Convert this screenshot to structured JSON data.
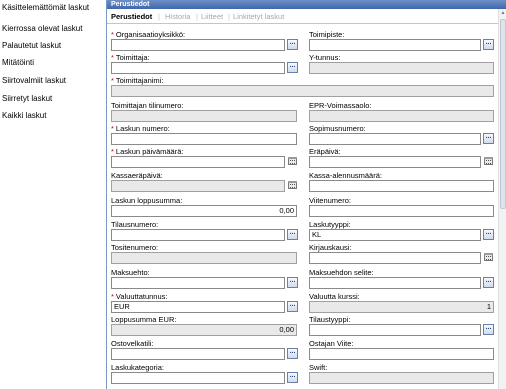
{
  "nav": {
    "items": [
      "Käsittelemättömät laskut",
      "Kierrossa olevat laskut",
      "Palautetut laskut",
      "Mitätöinti",
      "Siirtovalmiit laskut",
      "Siirretyt laskut",
      "Kaikki laskut"
    ]
  },
  "panel": {
    "title": "Perustiedot",
    "tabs": [
      "Perustiedot",
      "Historia",
      "Liitteet",
      "Linkitetyt laskut"
    ],
    "tab_separator": "|"
  },
  "form": {
    "required_marker": "*",
    "lookup_button": "...",
    "labels": {
      "organisaatioyksikko": "Organisaatioyksikkö:",
      "toimipiste": "Toimipiste:",
      "toimittaja": "Toimittaja:",
      "ytunnus": "Y-tunnus:",
      "toimittajanimi": "Toimittajanimi:",
      "tilinumero": "Toimittajan tilinumero:",
      "epr": "EPR-Voimassaolo:",
      "laskun_numero": "Laskun numero:",
      "sopimusnumero": "Sopimusnumero:",
      "paivamaara": "Laskun päivämäärä:",
      "erapaiva": "Eräpäivä:",
      "kassaerapaiva": "Kassaeräpäivä:",
      "kassa_alennus": "Kassa-alennusmäärä:",
      "loppusumma": "Laskun loppusumma:",
      "viitenumero": "Viitenumero:",
      "tilausnumero": "Tilausnumero:",
      "laskutyyppi": "Laskutyyppi:",
      "tositenumero": "Tositenumero:",
      "kirjauskausi": "Kirjauskausi:",
      "maksuehto": "Maksuehto:",
      "maksuehdon_selite": "Maksuehdon selite:",
      "valuuttatunnus": "Valuuttatunnus:",
      "valuutta_kurssi": "Valuutta kurssi:",
      "loppusumma_eur": "Loppusumma EUR:",
      "tilaustyyppi": "Tilaustyyppi:",
      "ostovelkatili": "Ostovelkatili:",
      "ostajan_viite": "Ostajan Viite:",
      "laskukategoria": "Laskukategoria:",
      "swift": "Swift:"
    },
    "values": {
      "organisaatioyksikko": "",
      "toimipiste": "",
      "toimittaja": "",
      "ytunnus": "",
      "toimittajanimi": "",
      "tilinumero": "",
      "epr": "",
      "laskun_numero": "",
      "sopimusnumero": "",
      "paivamaara": "",
      "erapaiva": "",
      "kassaerapaiva": "",
      "kassa_alennus": "",
      "loppusumma": "0,00",
      "viitenumero": "",
      "tilausnumero": "",
      "laskutyyppi": "KL",
      "tositenumero": "",
      "kirjauskausi": "",
      "maksuehto": "",
      "maksuehdon_selite": "",
      "valuuttatunnus": "EUR",
      "valuutta_kurssi": "1",
      "loppusumma_eur": "0,00",
      "tilaustyyppi": "",
      "ostovelkatili": "",
      "ostajan_viite": "",
      "laskukategoria": "",
      "swift": ""
    }
  },
  "colors": {
    "header_blue": "#3f67ad",
    "required_red": "#c00000",
    "readonly_gray": "#e9e9e9"
  }
}
